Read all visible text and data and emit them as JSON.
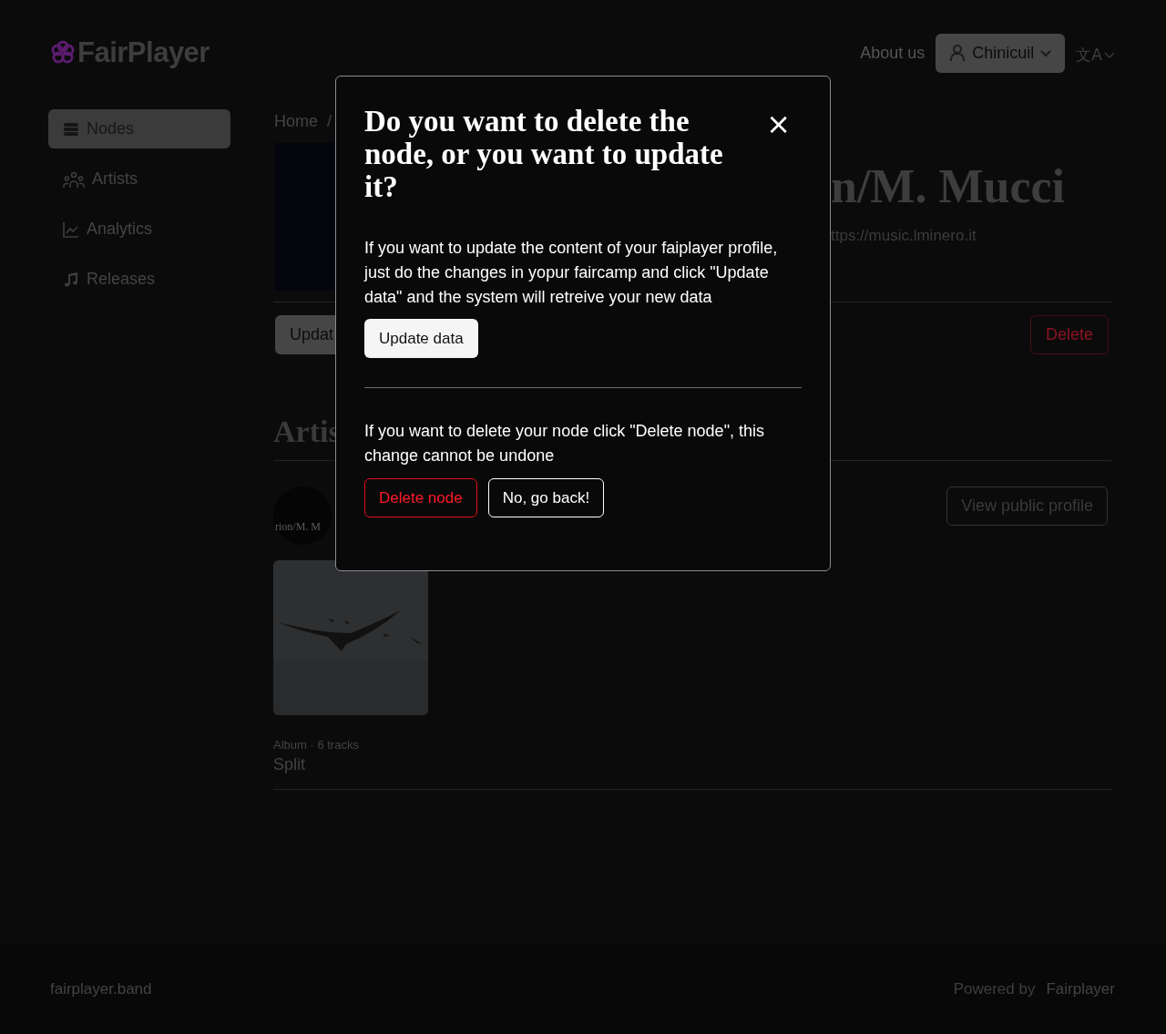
{
  "header": {
    "logo": "FairPlayer",
    "about": "About us",
    "user": "Chinicuil",
    "language": "文A"
  },
  "sidebar": {
    "items": [
      {
        "label": "Nodes",
        "selected": true
      },
      {
        "label": "Artists",
        "selected": false
      },
      {
        "label": "Analytics",
        "selected": false
      },
      {
        "label": "Releases",
        "selected": false
      }
    ]
  },
  "main": {
    "breadcrumb": [
      "Home",
      "/"
    ],
    "title": "n/M. Mucci",
    "url": "ttps://music.lminero.it",
    "update_button": "Updat",
    "delete_button": "Delete",
    "artists_heading": "Artis",
    "artist_name": "rion/M. M",
    "view_profile_button": "View public profile",
    "releases": [
      {
        "kind": "picture",
        "meta": "Album · 6 tracks",
        "title": "Split"
      }
    ]
  },
  "dialog": {
    "title": "Do you want to delete the node, or you want to update it?",
    "close": "×",
    "update_text": "If you want to update the content of your faiplayer profile, just do the changes in yopur faircamp and click \"Update data\" and the system will retreive your new data",
    "update_button": "Update data",
    "delete_text": "If you want to delete your node click \"Delete node\", this change cannot be undone",
    "delete_button": "Delete node",
    "back_button": "No, go back!"
  },
  "footer": {
    "site": "fairplayer.band",
    "powered_label": "Powered by",
    "powered_name": "Fairplayer"
  }
}
